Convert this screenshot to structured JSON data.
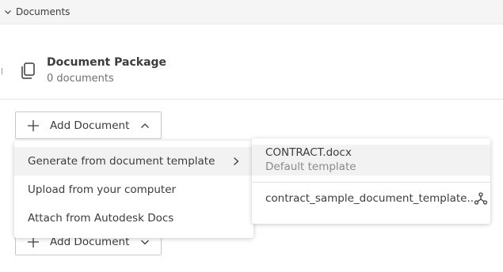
{
  "section": {
    "title": "Documents"
  },
  "package": {
    "title": "Document Package",
    "count": "0 documents"
  },
  "add_button": {
    "label": "Add Document"
  },
  "menu": {
    "items": [
      {
        "label": "Generate from document template"
      },
      {
        "label": "Upload from your computer"
      },
      {
        "label": "Attach from Autodesk Docs"
      }
    ]
  },
  "submenu": {
    "templates": [
      {
        "name": "CONTRACT.docx",
        "description": "Default template"
      },
      {
        "name": "contract_sample_document_template...."
      }
    ]
  },
  "icons": {
    "section_toggle": "chevron-down-icon",
    "package": "document-copy-icon",
    "add": "plus-icon",
    "top_caret": "chevron-up-icon",
    "bottom_caret": "chevron-down-icon",
    "submenu_arrow": "chevron-right-icon",
    "template_share": "shared-nodes-icon"
  }
}
